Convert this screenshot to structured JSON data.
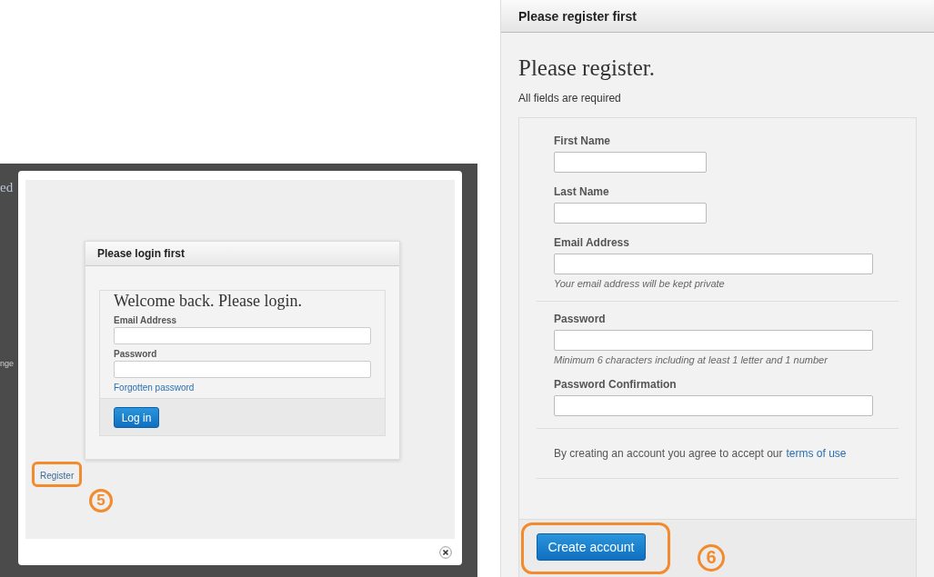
{
  "background_fragments": [
    "ed",
    "nge"
  ],
  "login_dialog": {
    "header": "Please login first",
    "heading": "Welcome back. Please login.",
    "fields": [
      {
        "label": "Email Address"
      },
      {
        "label": "Password"
      }
    ],
    "forgot_link": "Forgotten password",
    "submit": "Log in"
  },
  "register_link": "Register",
  "annotations": [
    "5",
    "6"
  ],
  "register_page": {
    "header": "Please register first",
    "heading": "Please register.",
    "note": "All fields are required",
    "sections": [
      {
        "fields": [
          {
            "label": "First Name",
            "kind": "short"
          },
          {
            "label": "Last Name",
            "kind": "short"
          },
          {
            "label": "Email Address",
            "kind": "long",
            "hint": "Your email address will be kept private"
          }
        ]
      },
      {
        "fields": [
          {
            "label": "Password",
            "kind": "long",
            "hint": "Minimum 6 characters including at least 1 letter and 1 number"
          },
          {
            "label": "Password Confirmation",
            "kind": "long"
          }
        ]
      }
    ],
    "agreement": "By creating an account you agree to accept our",
    "terms_link": "terms of use",
    "submit": "Create account"
  }
}
